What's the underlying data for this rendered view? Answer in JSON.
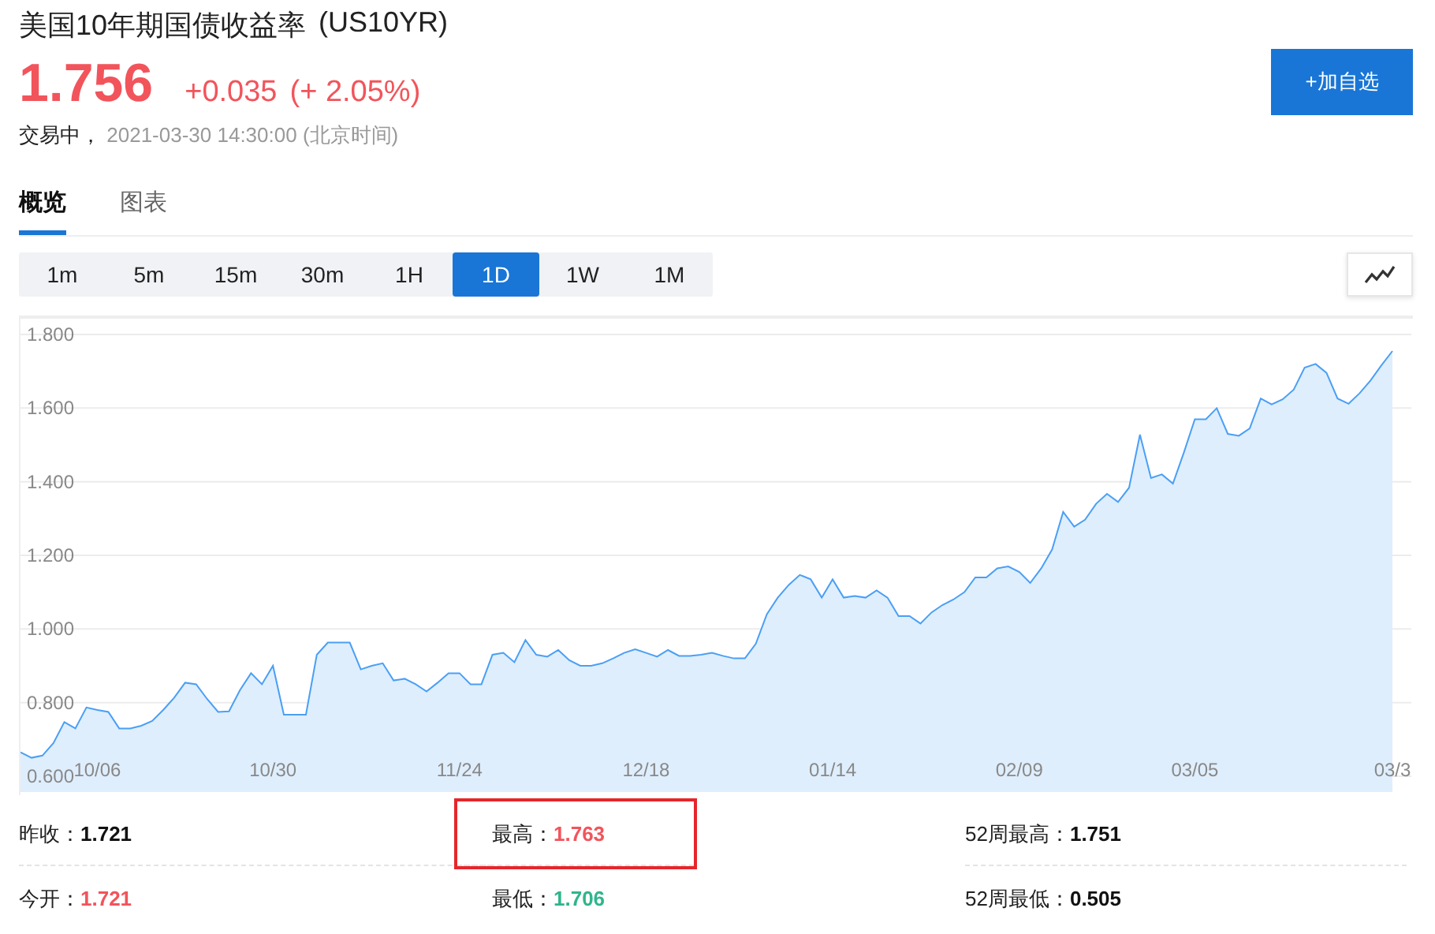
{
  "header": {
    "title": "美国10年期国债收益率",
    "code": "(US10YR)",
    "price": "1.756",
    "change": "+0.035",
    "change_pct": "(+ 2.05%)",
    "status": "交易中，",
    "time": "2021-03-30 14:30:00  (北京时间)",
    "add_button": "+加自选"
  },
  "tabs": [
    {
      "label": "概览",
      "selected": true
    },
    {
      "label": "图表",
      "selected": false
    }
  ],
  "periods": [
    {
      "label": "1m",
      "selected": false
    },
    {
      "label": "5m",
      "selected": false
    },
    {
      "label": "15m",
      "selected": false
    },
    {
      "label": "30m",
      "selected": false
    },
    {
      "label": "1H",
      "selected": false
    },
    {
      "label": "1D",
      "selected": true
    },
    {
      "label": "1W",
      "selected": false
    },
    {
      "label": "1M",
      "selected": false
    }
  ],
  "chart": {
    "chart_data": {
      "type": "area",
      "grid": true,
      "ylim": [
        0.6,
        1.8
      ],
      "categories": [
        null,
        null,
        null,
        null,
        null,
        null,
        null,
        "10/06",
        null,
        null,
        null,
        null,
        null,
        null,
        null,
        null,
        null,
        null,
        null,
        null,
        null,
        null,
        null,
        "10/30",
        null,
        null,
        null,
        null,
        null,
        null,
        null,
        null,
        null,
        null,
        null,
        null,
        null,
        null,
        null,
        null,
        "11/24",
        null,
        null,
        null,
        null,
        null,
        null,
        null,
        null,
        null,
        null,
        null,
        null,
        null,
        null,
        null,
        null,
        "12/18",
        null,
        null,
        null,
        null,
        null,
        null,
        null,
        null,
        null,
        null,
        null,
        null,
        null,
        null,
        null,
        null,
        "01/14",
        null,
        null,
        null,
        null,
        null,
        null,
        null,
        null,
        null,
        null,
        null,
        null,
        null,
        null,
        null,
        null,
        "02/09",
        null,
        null,
        null,
        null,
        null,
        null,
        null,
        null,
        null,
        null,
        null,
        null,
        null,
        null,
        null,
        "03/05",
        null,
        null,
        null,
        null,
        null,
        null,
        null,
        null,
        null,
        null,
        null,
        null,
        null,
        null,
        null,
        null,
        null,
        "03/3"
      ],
      "yticks": [
        {
          "value": 0.6,
          "label": "0.600"
        },
        {
          "value": 0.8,
          "label": "0.800"
        },
        {
          "value": 1.0,
          "label": "1.000"
        },
        {
          "value": 1.2,
          "label": "1.200"
        },
        {
          "value": 1.4,
          "label": "1.400"
        },
        {
          "value": 1.6,
          "label": "1.600"
        },
        {
          "value": 1.8,
          "label": "1.800"
        }
      ],
      "series": [
        {
          "color": "#4a9ff5",
          "values": [
            0.665,
            0.65,
            0.656,
            0.69,
            0.747,
            0.73,
            0.787,
            0.78,
            0.775,
            0.73,
            0.73,
            0.737,
            0.75,
            0.78,
            0.813,
            0.854,
            0.85,
            0.81,
            0.775,
            0.776,
            0.834,
            0.88,
            0.85,
            0.9,
            0.767,
            0.767,
            0.767,
            0.93,
            0.963,
            0.963,
            0.963,
            0.89,
            0.9,
            0.907,
            0.86,
            0.865,
            0.85,
            0.83,
            0.854,
            0.88,
            0.88,
            0.85,
            0.85,
            0.93,
            0.935,
            0.91,
            0.97,
            0.93,
            0.925,
            0.943,
            0.915,
            0.9,
            0.9,
            0.907,
            0.92,
            0.935,
            0.945,
            0.935,
            0.925,
            0.943,
            0.927,
            0.927,
            0.93,
            0.935,
            0.927,
            0.92,
            0.92,
            0.96,
            1.04,
            1.085,
            1.12,
            1.147,
            1.135,
            1.085,
            1.135,
            1.085,
            1.09,
            1.085,
            1.105,
            1.085,
            1.035,
            1.035,
            1.015,
            1.045,
            1.065,
            1.08,
            1.1,
            1.14,
            1.14,
            1.165,
            1.17,
            1.155,
            1.125,
            1.165,
            1.216,
            1.318,
            1.278,
            1.297,
            1.34,
            1.367,
            1.345,
            1.384,
            1.528,
            1.41,
            1.42,
            1.395,
            1.48,
            1.57,
            1.57,
            1.6,
            1.53,
            1.525,
            1.545,
            1.626,
            1.61,
            1.624,
            1.65,
            1.71,
            1.72,
            1.696,
            1.626,
            1.612,
            1.64,
            1.675,
            1.716,
            1.755
          ]
        }
      ]
    }
  },
  "stats": [
    {
      "label": "昨收：",
      "value": "1.721",
      "color": "#111111",
      "highlighted": false
    },
    {
      "label": "最高：",
      "value": "1.763",
      "color": "#f2545b",
      "highlighted": true
    },
    {
      "label": "52周最高：",
      "value": "1.751",
      "color": "#111111",
      "highlighted": false
    },
    {
      "label": "今开：",
      "value": "1.721",
      "color": "#f2545b",
      "highlighted": false
    },
    {
      "label": "最低：",
      "value": "1.706",
      "color": "#2fb58c",
      "highlighted": false
    },
    {
      "label": "52周最低：",
      "value": "0.505",
      "color": "#111111",
      "highlighted": false
    }
  ]
}
